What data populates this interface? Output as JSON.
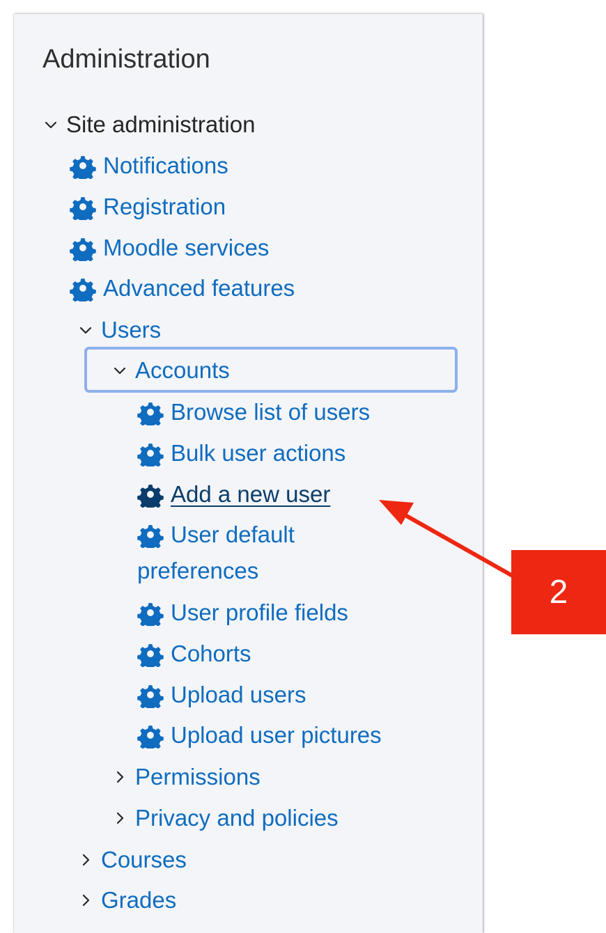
{
  "panel": {
    "title": "Administration"
  },
  "tree": {
    "site_admin": "Site administration",
    "notifications": "Notifications",
    "registration": "Registration",
    "moodle_services": "Moodle services",
    "advanced_features": "Advanced features",
    "users": "Users",
    "accounts": "Accounts",
    "browse_list": "Browse list of users",
    "bulk_actions": "Bulk user actions",
    "add_new_user": "Add a new user",
    "user_default_line1": "User default",
    "user_default_line2": "preferences",
    "user_profile_fields": "User profile fields",
    "cohorts": "Cohorts",
    "upload_users": "Upload users",
    "upload_pictures": "Upload user pictures",
    "permissions": "Permissions",
    "privacy": "Privacy and policies",
    "courses": "Courses",
    "grades": "Grades"
  },
  "icons": {
    "expanded": "chevron-down-icon",
    "collapsed": "chevron-right-icon",
    "settings": "gear-icon"
  },
  "callout": {
    "label": "2",
    "color": "#ee2712"
  },
  "colors": {
    "link": "#0f6cbf",
    "current_link": "#0a3d6b",
    "focus_outline": "#8db0ec",
    "panel_bg": "#f4f5f9"
  }
}
